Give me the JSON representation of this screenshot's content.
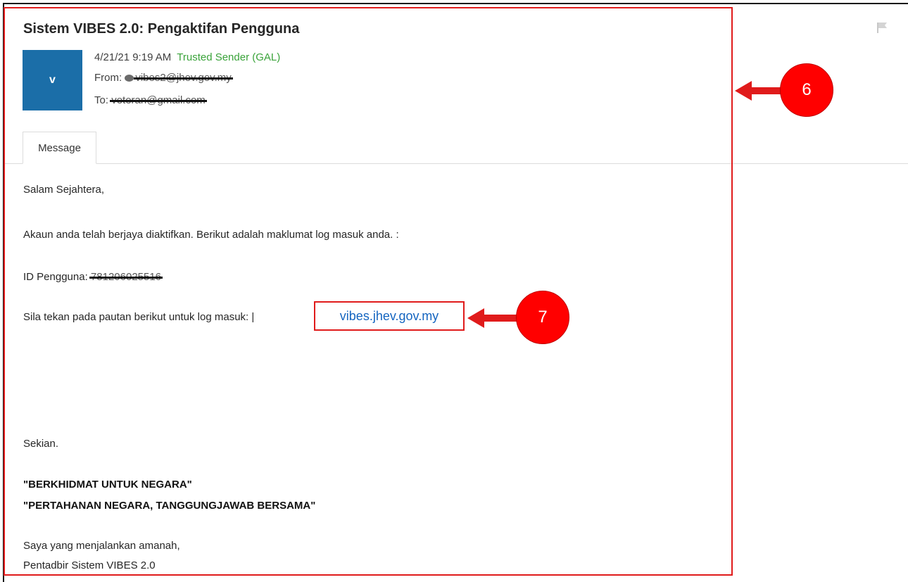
{
  "email": {
    "subject": "Sistem VIBES 2.0: Pengaktifan Pengguna",
    "avatar_letter": "v",
    "date": "4/21/21 9:19 AM",
    "trusted": "Trusted Sender (GAL)",
    "from_label": "From:",
    "from_value": "vibes2@jhev.gov.my",
    "to_label": "To:",
    "to_value": "veteran@gmail.com",
    "tab_label": "Message"
  },
  "body": {
    "greeting": "Salam Sejahtera,",
    "line1": "Akaun anda telah berjaya diaktifkan. Berikut adalah maklumat log masuk anda. :",
    "id_label": "ID Pengguna:",
    "id_value": "781206025516",
    "link_prompt": "Sila tekan pada pautan berikut untuk log masuk: |",
    "link_text": "vibes.jhev.gov.my",
    "closing": "Sekian.",
    "motto1": "\"BERKHIDMAT UNTUK NEGARA\"",
    "motto2": "\"PERTAHANAN NEGARA, TANGGUNGJAWAB BERSAMA\"",
    "sign1": "Saya yang menjalankan amanah,",
    "sign2": "Pentadbir Sistem VIBES 2.0"
  },
  "annotations": {
    "callout_6": "6",
    "callout_7": "7",
    "highlight_color": "#e01b1b"
  },
  "colors": {
    "avatar_bg": "#1b6ea8",
    "trusted_green": "#3aa33a",
    "link_blue": "#1565c0"
  },
  "icons": [
    "flag-icon",
    "arrow-left-icon"
  ]
}
